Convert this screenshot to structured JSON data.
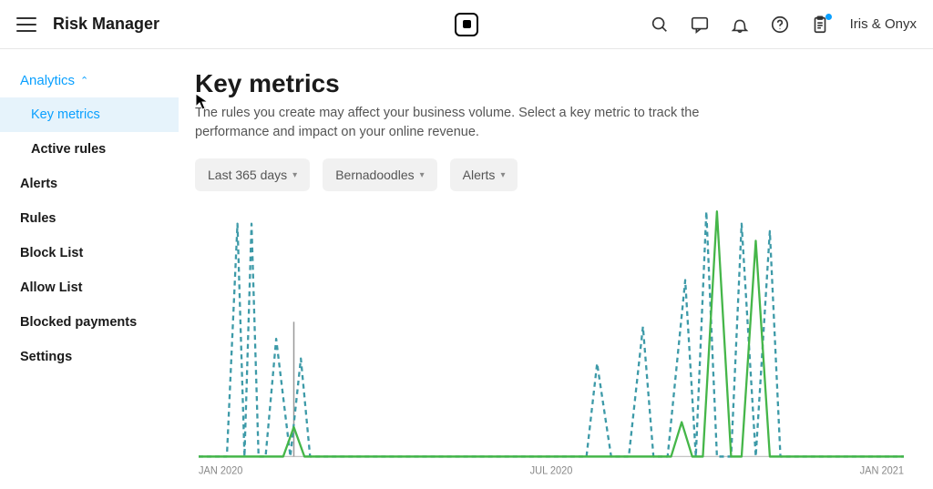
{
  "header": {
    "title": "Risk Manager",
    "merchant": "Iris & Onyx"
  },
  "sidebar": {
    "section": {
      "label": "Analytics",
      "expanded": true
    },
    "subitems": [
      {
        "label": "Key metrics",
        "active": true
      },
      {
        "label": "Active rules",
        "active": false
      }
    ],
    "items": [
      {
        "label": "Alerts"
      },
      {
        "label": "Rules"
      },
      {
        "label": "Block List"
      },
      {
        "label": "Allow List"
      },
      {
        "label": "Blocked payments"
      },
      {
        "label": "Settings"
      }
    ]
  },
  "main": {
    "title": "Key metrics",
    "description": "The rules you create may affect your business volume. Select a key metric to track the performance and impact on your online revenue.",
    "filters": [
      {
        "label": "Last 365 days"
      },
      {
        "label": "Bernadoodles"
      },
      {
        "label": "Alerts"
      }
    ]
  },
  "chart_data": {
    "type": "line",
    "title": "",
    "xlabel": "",
    "ylabel": "",
    "x_range": [
      "JAN 2020",
      "JAN 2021"
    ],
    "x_ticks": [
      "JAN 2020",
      "JUL 2020",
      "JAN 2021"
    ],
    "ylim": [
      0,
      100
    ],
    "series": [
      {
        "name": "series-a-dashed",
        "style": "dashed",
        "color": "#3d9aa8",
        "x": [
          0,
          0.04,
          0.055,
          0.065,
          0.075,
          0.085,
          0.095,
          0.11,
          0.13,
          0.145,
          0.158,
          0.17,
          0.19,
          0.21,
          0.23,
          0.46,
          0.55,
          0.565,
          0.585,
          0.61,
          0.63,
          0.645,
          0.665,
          0.69,
          0.705,
          0.72,
          0.735,
          0.755,
          0.77,
          0.79,
          0.81,
          0.825,
          0.845,
          0.87,
          1.0
        ],
        "y": [
          0,
          0,
          95,
          0,
          95,
          0,
          0,
          48,
          0,
          40,
          0,
          0,
          0,
          0,
          0,
          0,
          0,
          38,
          0,
          0,
          53,
          0,
          0,
          72,
          0,
          100,
          0,
          0,
          95,
          0,
          92,
          0,
          0,
          0,
          0
        ]
      },
      {
        "name": "series-b-solid",
        "style": "solid",
        "color": "#45b649",
        "x": [
          0,
          0.12,
          0.135,
          0.15,
          0.6,
          0.67,
          0.685,
          0.7,
          0.715,
          0.735,
          0.755,
          0.77,
          0.79,
          0.81,
          1.0
        ],
        "y": [
          0,
          0,
          12,
          0,
          0,
          0,
          14,
          0,
          0,
          100,
          0,
          0,
          88,
          0,
          0
        ]
      }
    ]
  }
}
